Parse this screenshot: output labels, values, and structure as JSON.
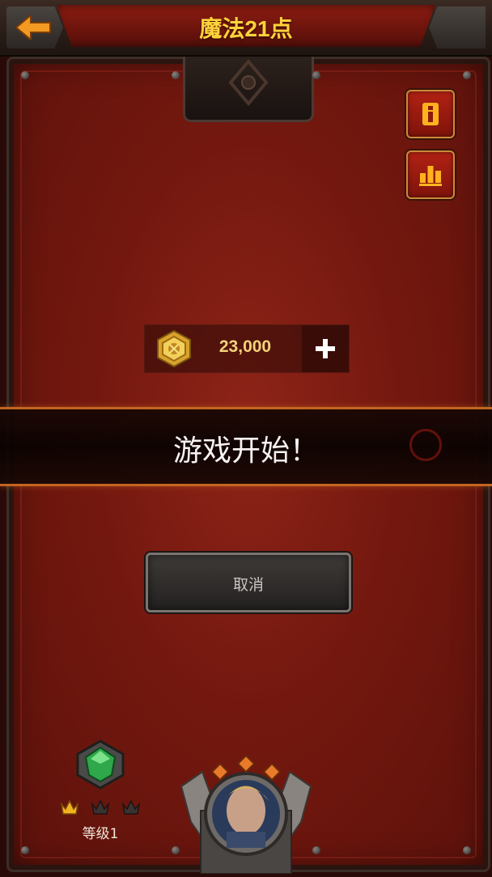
{
  "header": {
    "title": "魔法21点"
  },
  "coins": {
    "value": "23,000"
  },
  "banner": {
    "text": "游戏开始！"
  },
  "cancel": {
    "label": "取消"
  },
  "level": {
    "label": "等级1",
    "stars_filled": 1,
    "stars_total": 3
  },
  "colors": {
    "accent": "#ffd23a",
    "frame": "#74180f",
    "banner_border": "#c86a22"
  },
  "icons": [
    "back-arrow-icon",
    "info-icon",
    "leaderboard-icon",
    "coin-icon",
    "plus-icon",
    "gem-icon",
    "star-icon",
    "avatar"
  ]
}
